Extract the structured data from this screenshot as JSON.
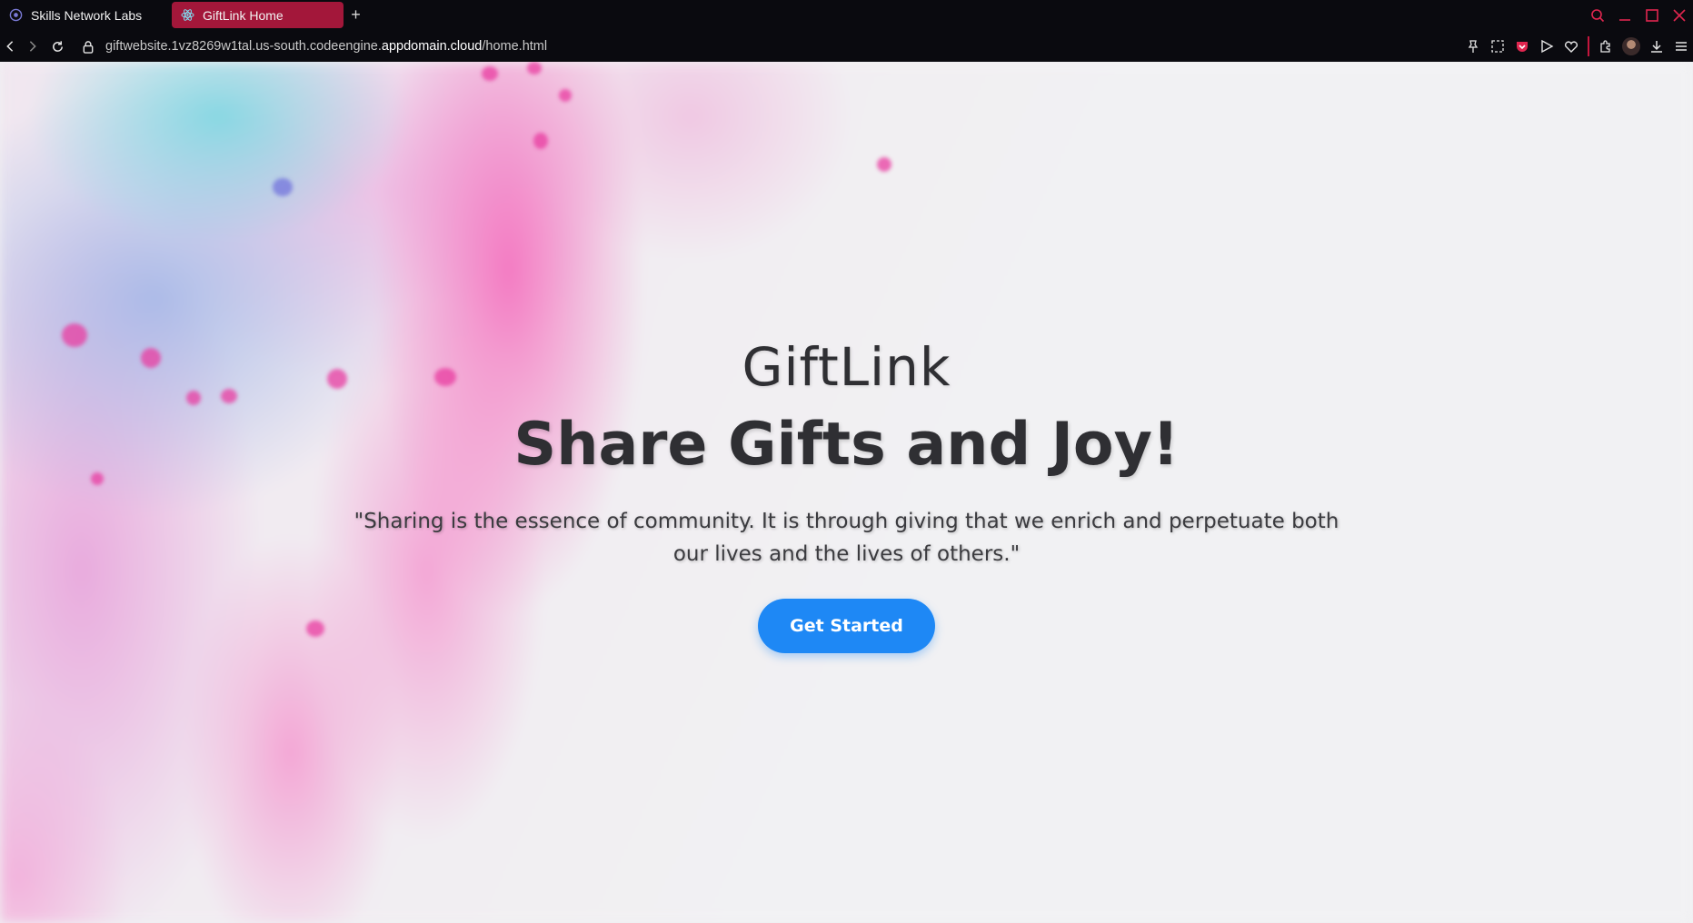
{
  "browser": {
    "tabs": [
      {
        "label": "Skills Network Labs",
        "icon": "skills-network-icon",
        "active": false
      },
      {
        "label": "GiftLink Home",
        "icon": "react-icon",
        "active": true
      }
    ],
    "new_tab": "+",
    "address": {
      "prefix": "giftwebsite.1vz8269w1tal.us-south.codeengine.",
      "domain": "appdomain.cloud",
      "path": "/home.html"
    },
    "accent_color": "#a3173a",
    "toolbar_icons": [
      "pin-icon",
      "screenshot-icon",
      "pocket-icon",
      "send-icon",
      "heart-icon",
      "extensions-icon",
      "profile-avatar",
      "download-icon",
      "menu-icon"
    ],
    "window_icons": [
      "search-icon",
      "minimize-icon",
      "maximize-icon",
      "close-icon"
    ]
  },
  "page": {
    "brand": "GiftLink",
    "headline": "Share Gifts and Joy!",
    "quote": "\"Sharing is the essence of community. It is through giving that we enrich and perpetuate both our lives and the lives of others.\"",
    "cta_label": "Get Started",
    "cta_color": "#1e88f5"
  }
}
